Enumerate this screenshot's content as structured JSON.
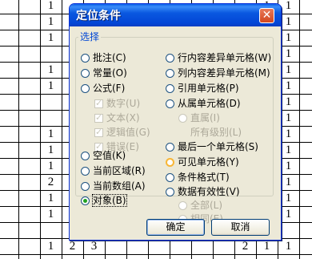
{
  "sheet_cells": [
    {
      "t": "1",
      "c": 2,
      "r": 0
    },
    {
      "t": "1",
      "c": 12,
      "r": 0
    },
    {
      "t": "1",
      "c": 13,
      "r": 0
    },
    {
      "t": "1",
      "c": 2,
      "r": 1
    },
    {
      "t": "1",
      "c": 12,
      "r": 1
    },
    {
      "t": "1",
      "c": 13,
      "r": 1
    },
    {
      "t": "1",
      "c": 2,
      "r": 2
    },
    {
      "t": "1",
      "c": 12,
      "r": 2
    },
    {
      "t": "1",
      "c": 13,
      "r": 2
    },
    {
      "t": "1",
      "c": 12,
      "r": 3
    },
    {
      "t": "1",
      "c": 13,
      "r": 3
    },
    {
      "t": "1",
      "c": 2,
      "r": 4
    },
    {
      "t": "1",
      "c": 12,
      "r": 4
    },
    {
      "t": "1",
      "c": 13,
      "r": 4
    },
    {
      "t": "1",
      "c": 2,
      "r": 5
    },
    {
      "t": "1",
      "c": 12,
      "r": 5
    },
    {
      "t": "1",
      "c": 13,
      "r": 5
    },
    {
      "t": "1",
      "c": 12,
      "r": 6
    },
    {
      "t": "1",
      "c": 13,
      "r": 6
    },
    {
      "t": "1",
      "c": 12,
      "r": 7
    },
    {
      "t": "1",
      "c": 13,
      "r": 7
    },
    {
      "t": "1",
      "c": 2,
      "r": 8
    },
    {
      "t": "1",
      "c": 12,
      "r": 8
    },
    {
      "t": "1",
      "c": 13,
      "r": 8
    },
    {
      "t": "1",
      "c": 2,
      "r": 9
    },
    {
      "t": "1",
      "c": 12,
      "r": 9
    },
    {
      "t": "1",
      "c": 13,
      "r": 9
    },
    {
      "t": "1",
      "c": 2,
      "r": 10
    },
    {
      "t": "1",
      "c": 12,
      "r": 10
    },
    {
      "t": "1",
      "c": 13,
      "r": 10
    },
    {
      "t": "2",
      "c": 2,
      "r": 11
    },
    {
      "t": "1",
      "c": 12,
      "r": 11
    },
    {
      "t": "1",
      "c": 13,
      "r": 11
    },
    {
      "t": "1",
      "c": 2,
      "r": 12
    },
    {
      "t": "1",
      "c": 12,
      "r": 12
    },
    {
      "t": "1",
      "c": 13,
      "r": 12
    },
    {
      "t": "1",
      "c": 2,
      "r": 13
    },
    {
      "t": "1",
      "c": 12,
      "r": 13
    },
    {
      "t": "1",
      "c": 13,
      "r": 13
    },
    {
      "t": "1",
      "c": 2,
      "r": 15
    },
    {
      "t": "2",
      "c": 3,
      "r": 15
    },
    {
      "t": "3",
      "c": 4,
      "r": 15
    },
    {
      "t": "2",
      "c": 11,
      "r": 15
    },
    {
      "t": "1",
      "c": 12,
      "r": 15
    },
    {
      "t": "1",
      "c": 13,
      "r": 15
    }
  ],
  "dialog": {
    "title": "定位条件",
    "close_glyph": "✕",
    "group_label": "选择",
    "left_options": [
      {
        "label": "批注(C)",
        "state": "normal"
      },
      {
        "label": "常量(O)",
        "state": "normal"
      },
      {
        "label": "公式(F)",
        "state": "normal"
      }
    ],
    "formula_checks": [
      {
        "label": "数字(U)",
        "checked": true
      },
      {
        "label": "文本(X)",
        "checked": true
      },
      {
        "label": "逻辑值(G)",
        "checked": true
      },
      {
        "label": "错误(E)",
        "checked": true
      }
    ],
    "left_options_2": [
      {
        "label": "空值(K)",
        "state": "normal"
      },
      {
        "label": "当前区域(R)",
        "state": "normal"
      },
      {
        "label": "当前数组(A)",
        "state": "normal"
      },
      {
        "label": "对象(B)",
        "state": "selected"
      }
    ],
    "right_options": [
      {
        "label": "行内容差异单元格(W)"
      },
      {
        "label": "列内容差异单元格(M)"
      },
      {
        "label": "引用单元格(P)"
      },
      {
        "label": "从属单元格(D)"
      }
    ],
    "dependents_sub": [
      {
        "label": "直属(I)",
        "selected": true
      },
      {
        "label": "所有级别(L)",
        "selected": false
      }
    ],
    "right_options_2": [
      {
        "label": "最后一个单元格(S)",
        "hover": false
      },
      {
        "label": "可见单元格(Y)",
        "hover": true
      },
      {
        "label": "条件格式(T)",
        "hover": false
      },
      {
        "label": "数据有效性(V)",
        "hover": false
      }
    ],
    "validation_sub": [
      {
        "label": "全部(L)",
        "selected": true
      },
      {
        "label": "相同(E)",
        "selected": false
      }
    ],
    "ok_label": "确定",
    "cancel_label": "取消"
  }
}
